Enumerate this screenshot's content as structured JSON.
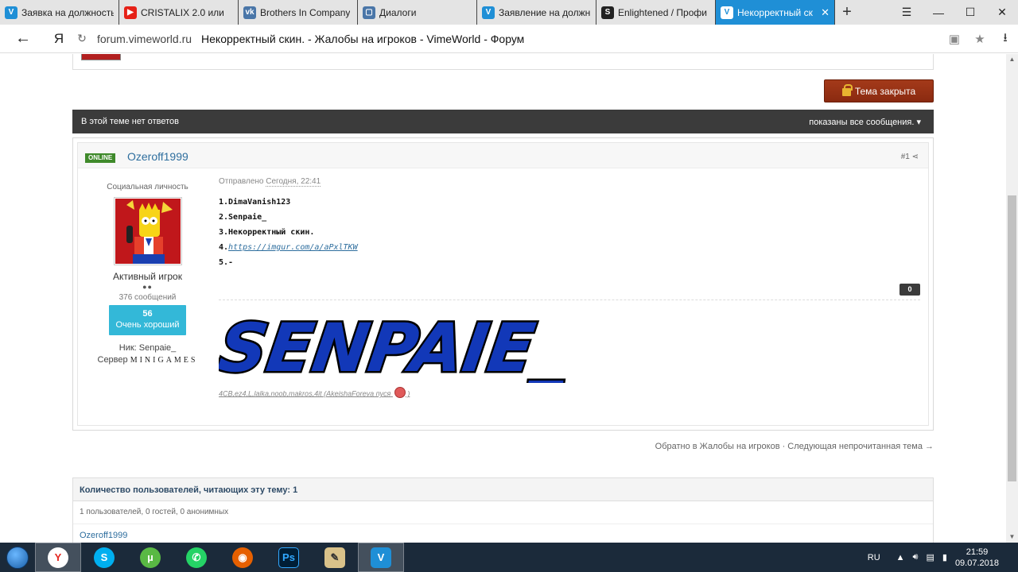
{
  "browser": {
    "tabs": [
      {
        "label": "Заявка на должность",
        "favicon": "vimeworld-icon",
        "color": "#1f8fd6",
        "active": false
      },
      {
        "label": "CRISTALIX 2.0 или",
        "favicon": "youtube-icon",
        "color": "#e62117",
        "active": false
      },
      {
        "label": "Brothers In Company",
        "favicon": "vk-icon",
        "color": "#4a76a8",
        "active": false
      },
      {
        "label": "Диалоги",
        "favicon": "vk-messages-icon",
        "color": "#4a76a8",
        "active": false
      },
      {
        "label": "Заявление на должн",
        "favicon": "vimeworld-icon",
        "color": "#1f8fd6",
        "active": false
      },
      {
        "label": "Enlightened / Профи",
        "favicon": "s-icon",
        "color": "#222222",
        "active": false
      },
      {
        "label": "Некорректный ск",
        "favicon": "vimeworld-icon",
        "color": "#1f8fd6",
        "active": true
      }
    ],
    "address": {
      "host": "forum.vimeworld.ru",
      "title": "Некорректный скин. - Жалобы на игроков - VimeWorld - Форум",
      "yandex": "Я"
    }
  },
  "page": {
    "closed_button": "Тема закрыта",
    "thread_bar": {
      "left": "В этой теме нет ответов",
      "right": "показаны все сообщения."
    },
    "post": {
      "online_badge": "ONLINE",
      "author": "Ozeroff1999",
      "number": "#1",
      "user_title": "Социальная личность",
      "role": "Активный игрок",
      "pips": "●●",
      "post_count": "376 сообщений",
      "reputation": {
        "value": "56",
        "label": "Очень хороший"
      },
      "nick": "Ник: Senpaie_",
      "server_prefix": "Сервер",
      "server_name": "MINIGAMES",
      "posted_prefix": "Отправлено",
      "posted_date": "Сегодня, 22:41",
      "lines": [
        "1.DimaVanish123",
        "2.Senpaie_",
        "3.Некорректный скин.",
        "4.",
        "5.-"
      ],
      "link": "https://imgur.com/a/aPxlTKW",
      "rep_count": "0",
      "signature_banner": "SENPAIE_",
      "signature_text": "4CB,ez4,L,lalka,noob,makros,4it (AkeishaForeva пуся"
    },
    "bottom_links": "Обратно в Жалобы на игроков · Следующая непрочитанная тема →",
    "viewers": {
      "heading": "Количество пользователей, читающих эту тему: 1",
      "counts": "1 пользователей, 0 гостей, 0 анонимных",
      "names": "Ozeroff1999"
    }
  },
  "taskbar": {
    "apps": [
      "yandex-browser-icon",
      "skype-icon",
      "utorrent-icon",
      "whatsapp-icon",
      "firefox-icon",
      "photoshop-icon",
      "paint-icon",
      "vimeworld-icon"
    ],
    "lang": "RU",
    "time": "21:59",
    "date": "09.07.2018"
  }
}
